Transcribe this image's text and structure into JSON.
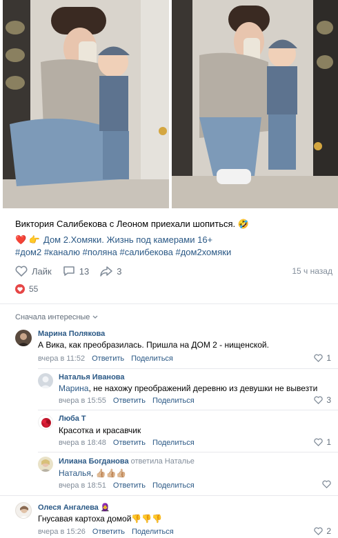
{
  "photos": [
    {
      "name": "photo-1"
    },
    {
      "name": "photo-2"
    }
  ],
  "post": {
    "text": "Виктория Салибекова с Леоном приехали шопиться.",
    "text_emoji": "🤣",
    "tags_line1_emoji": "❤️ 👉",
    "tags_line1": "Дом 2.Хомяки. Жизнь под камерами 16+",
    "tags_line2": "#дом2 #каналю #поляна #салибекова #дом2хомяки"
  },
  "actions": {
    "like_label": "Лайк",
    "comments_count": "13",
    "shares_count": "3",
    "time_ago": "15 ч назад"
  },
  "reactions": {
    "count": "55"
  },
  "sort_label": "Сначала интересные",
  "comments": [
    {
      "name": "Марина Полякова",
      "text": "А Вика, как преобразилась. Пришла на ДОМ 2 - нищенской.",
      "time": "вчера в 11:52",
      "reply": "Ответить",
      "share": "Поделиться",
      "likes": "1"
    },
    {
      "name": "Наталья Иванова",
      "addressee": "Марина",
      "text": ", не нахожу преображений деревню из девушки не вывезти",
      "time": "вчера в 15:55",
      "reply": "Ответить",
      "share": "Поделиться",
      "likes": "3"
    },
    {
      "name": "Люба Т",
      "text": "Красотка и красавчик",
      "time": "вчера в 18:48",
      "reply": "Ответить",
      "share": "Поделиться",
      "likes": "1"
    },
    {
      "name": "Илиана Богданова",
      "reply_to": "ответила Наталье",
      "addressee": "Наталья",
      "text": ", 👍🏼👍🏼👍🏼",
      "time": "вчера в 18:51",
      "reply": "Ответить",
      "share": "Поделиться"
    },
    {
      "name": "Олеся Ангалева",
      "name_emoji": "🧕",
      "text": "Гнусавая картоха домой👎👎👎",
      "time": "вчера в 15:26",
      "reply": "Ответить",
      "share": "Поделиться",
      "likes": "2"
    }
  ],
  "colors": {
    "link": "#2a5885",
    "meta": "#818c99",
    "divider": "#e7e8ec",
    "heart": "#e64646"
  }
}
